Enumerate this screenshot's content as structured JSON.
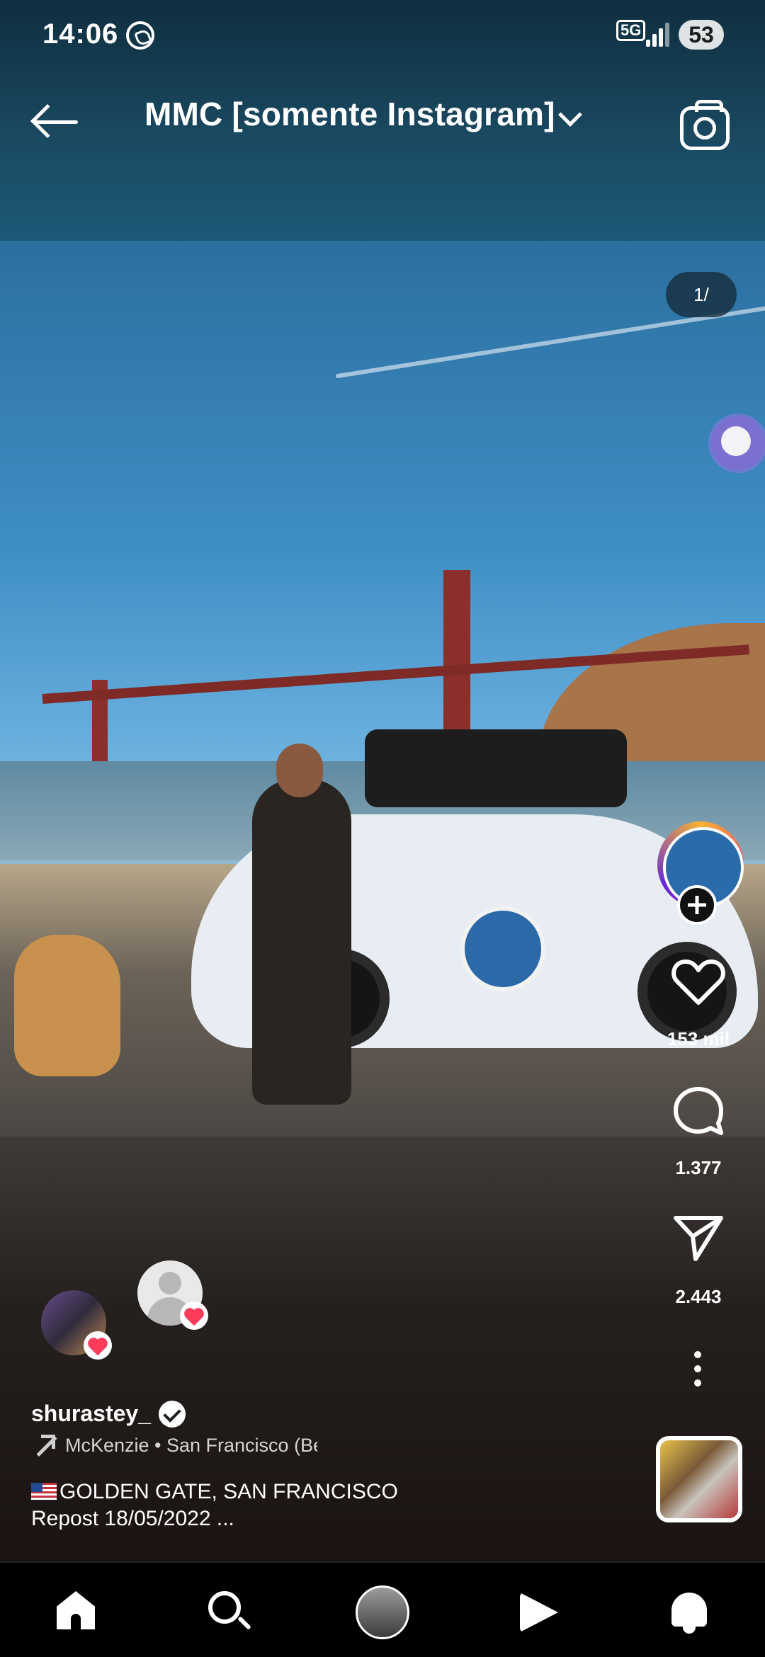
{
  "status_bar": {
    "time": "14:06",
    "network": "5G",
    "battery": "53",
    "icons": [
      "whatsapp-icon",
      "signal-icon",
      "battery-icon"
    ]
  },
  "header": {
    "title": "MMC [somente Instagram]",
    "icons": [
      "back-arrow-icon",
      "chevron-down-icon",
      "camera-icon"
    ]
  },
  "post": {
    "page_indicator": "1/",
    "username": "shurastey_",
    "music": "McKenzie • San Francisco (Be",
    "caption_line1": "GOLDEN GATE, SAN FRANCISCO",
    "caption_line2": "Repost 18/05/2022",
    "caption_more": "...",
    "flag": "🇺🇸"
  },
  "actions": {
    "likes": "153 mil",
    "comments": "1.377",
    "shares": "2.443"
  },
  "nav": {
    "items": [
      "home-icon",
      "search-icon",
      "profile-avatar",
      "reels-icon",
      "notifications-icon"
    ]
  },
  "colors": {
    "accent_heart": "#ff3b5c",
    "background": "#000000"
  }
}
